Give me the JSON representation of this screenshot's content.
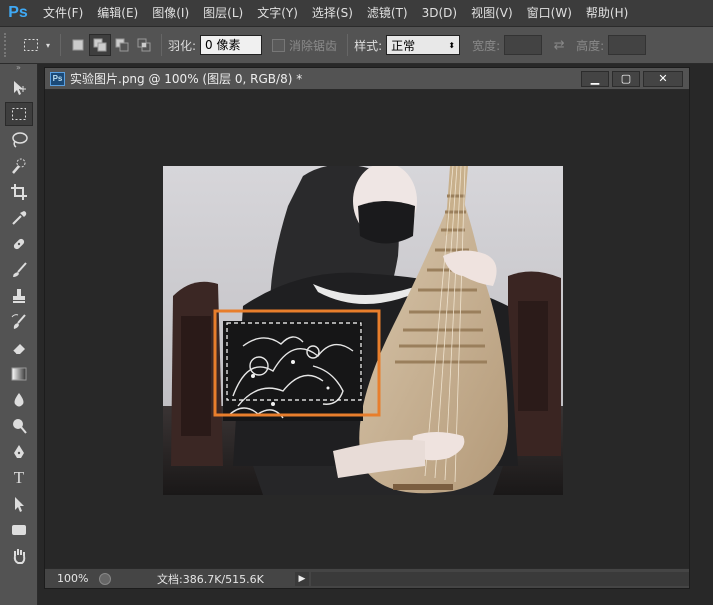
{
  "app": {
    "logo": "Ps"
  },
  "menu": [
    "文件(F)",
    "编辑(E)",
    "图像(I)",
    "图层(L)",
    "文字(Y)",
    "选择(S)",
    "滤镜(T)",
    "3D(D)",
    "视图(V)",
    "窗口(W)",
    "帮助(H)"
  ],
  "options": {
    "feather_label": "羽化:",
    "feather_value": "0 像素",
    "antialias_label": "消除锯齿",
    "style_label": "样式:",
    "style_value": "正常",
    "width_label": "宽度:",
    "height_label": "高度:"
  },
  "document": {
    "icon_text": "Ps",
    "title": "实验图片.png @ 100% (图层 0, RGB/8) *",
    "zoom": "100%",
    "doc_size": "文档:386.7K/515.6K"
  },
  "colors": {
    "accent": "#3fa9f5",
    "highlight_box": "#e87e2c"
  }
}
